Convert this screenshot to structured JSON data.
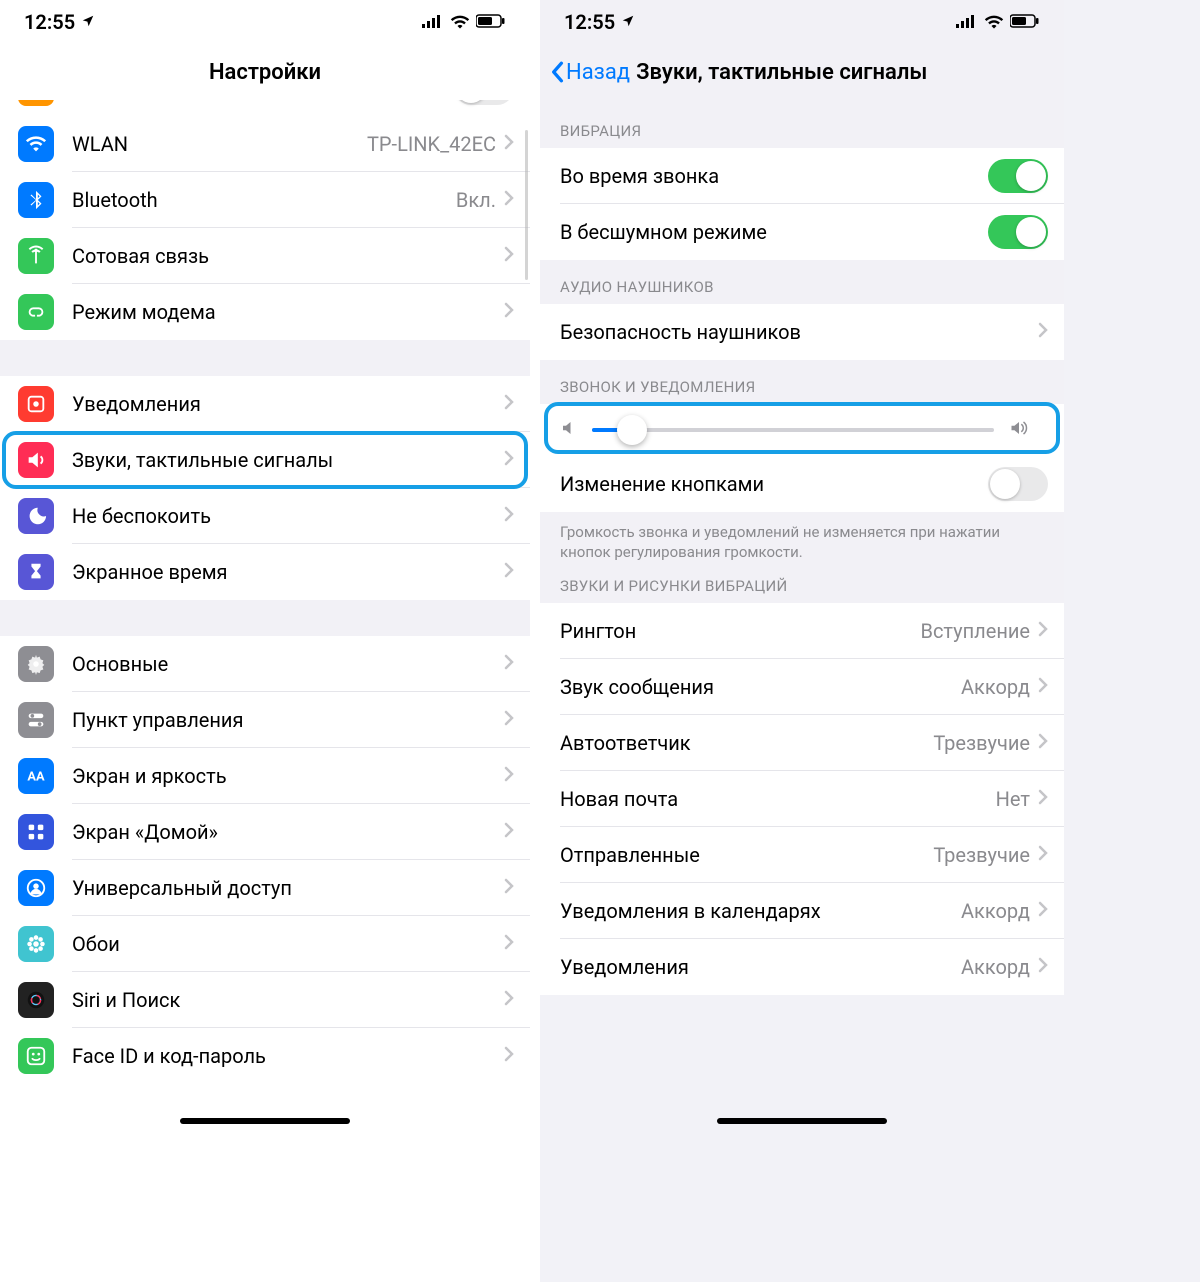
{
  "status": {
    "time": "12:55"
  },
  "left": {
    "title": "Настройки",
    "items": [
      {
        "id": "wlan",
        "label": "WLAN",
        "value": "TP-LINK_42EC",
        "icon": "wifi",
        "color": "#007aff"
      },
      {
        "id": "bluetooth",
        "label": "Bluetooth",
        "value": "Вкл.",
        "icon": "bluetooth",
        "color": "#007aff"
      },
      {
        "id": "cellular",
        "label": "Сотовая связь",
        "value": "",
        "icon": "antenna",
        "color": "#34c759"
      },
      {
        "id": "hotspot",
        "label": "Режим модема",
        "value": "",
        "icon": "link",
        "color": "#34c759"
      }
    ],
    "items2": [
      {
        "id": "notifications",
        "label": "Уведомления",
        "icon": "bell",
        "color": "#ff3b30"
      },
      {
        "id": "sounds",
        "label": "Звуки, тактильные сигналы",
        "icon": "speaker",
        "color": "#ff2d55",
        "highlight": true
      },
      {
        "id": "dnd",
        "label": "Не беспокоить",
        "icon": "moon",
        "color": "#5856d6"
      },
      {
        "id": "screentime",
        "label": "Экранное время",
        "icon": "hourglass",
        "color": "#5856d6"
      }
    ],
    "items3": [
      {
        "id": "general",
        "label": "Основные",
        "icon": "gear",
        "color": "#8e8e93"
      },
      {
        "id": "controlcenter",
        "label": "Пункт управления",
        "icon": "switches",
        "color": "#8e8e93"
      },
      {
        "id": "display",
        "label": "Экран и яркость",
        "icon": "aa",
        "color": "#007aff"
      },
      {
        "id": "homescreen",
        "label": "Экран «Домой»",
        "icon": "grid",
        "color": "#3355dd"
      },
      {
        "id": "accessibility",
        "label": "Универсальный доступ",
        "icon": "person",
        "color": "#007aff"
      },
      {
        "id": "wallpaper",
        "label": "Обои",
        "icon": "flower",
        "color": "#40c4d0"
      },
      {
        "id": "siri",
        "label": "Siri и Поиск",
        "icon": "siri",
        "color": "#222"
      },
      {
        "id": "faceid",
        "label": "Face ID и код-пароль",
        "icon": "face",
        "color": "#34c759"
      }
    ]
  },
  "right": {
    "back": "Назад",
    "title": "Звуки, тактильные сигналы",
    "sections": {
      "vibration_header": "ВИБРАЦИЯ",
      "vibrate_ring": "Во время звонка",
      "vibrate_silent": "В бесшумном режиме",
      "headphone_header": "АУДИО НАУШНИКОВ",
      "headphone_safety": "Безопасность наушников",
      "ringer_header": "ЗВОНОК И УВЕДОМЛЕНИЯ",
      "change_buttons": "Изменение кнопками",
      "change_buttons_footer": "Громкость звонка и уведомлений не изменяется при нажатии кнопок регулирования громкости.",
      "patterns_header": "ЗВУКИ И РИСУНКИ ВИБРАЦИЙ"
    },
    "toggles": {
      "vibrate_ring": true,
      "vibrate_silent": true,
      "change_buttons": false
    },
    "slider": {
      "value_pct": 10
    },
    "sounds": [
      {
        "id": "ringtone",
        "label": "Рингтон",
        "value": "Вступление"
      },
      {
        "id": "texttone",
        "label": "Звук сообщения",
        "value": "Аккорд"
      },
      {
        "id": "voicemail",
        "label": "Автоответчик",
        "value": "Трезвучие"
      },
      {
        "id": "newmail",
        "label": "Новая почта",
        "value": "Нет"
      },
      {
        "id": "sentmail",
        "label": "Отправленные",
        "value": "Трезвучие"
      },
      {
        "id": "calendar",
        "label": "Уведомления в календарях",
        "value": "Аккорд"
      },
      {
        "id": "reminders",
        "label": "Уведомления",
        "value": "Аккорд"
      }
    ]
  }
}
